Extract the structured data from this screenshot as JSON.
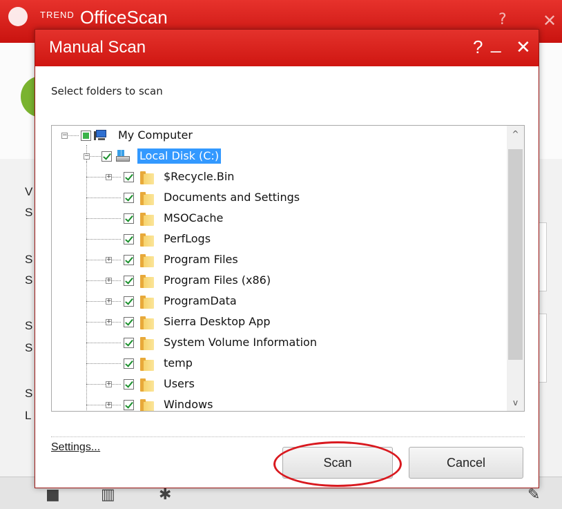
{
  "background_app": {
    "brand": "TREND",
    "product": "OfficeScan",
    "help_glyph": "?",
    "close_glyph": "✕",
    "partial_letters": [
      "V",
      "S",
      "S",
      "S",
      "S",
      "S",
      "S",
      "L"
    ]
  },
  "dialog": {
    "title": "Manual Scan",
    "help_glyph": "?",
    "minimize_glyph": "_",
    "close_glyph": "✕",
    "instruction": "Select folders to scan",
    "tree": {
      "root": {
        "label": "My Computer",
        "state": "partial",
        "expanded": true,
        "icon": "computer-icon"
      },
      "drive": {
        "label": "Local Disk (C:)",
        "state": "checked",
        "expanded": true,
        "selected": true,
        "icon": "disk-icon"
      },
      "folders": [
        {
          "label": "$Recycle.Bin",
          "expandable": true
        },
        {
          "label": "Documents and Settings",
          "expandable": false
        },
        {
          "label": "MSOCache",
          "expandable": false
        },
        {
          "label": "PerfLogs",
          "expandable": false
        },
        {
          "label": "Program Files",
          "expandable": true
        },
        {
          "label": "Program Files (x86)",
          "expandable": true
        },
        {
          "label": "ProgramData",
          "expandable": true
        },
        {
          "label": "Sierra Desktop App",
          "expandable": true
        },
        {
          "label": "System Volume Information",
          "expandable": false
        },
        {
          "label": "temp",
          "expandable": false
        },
        {
          "label": "Users",
          "expandable": true
        },
        {
          "label": "Windows",
          "expandable": true
        }
      ]
    },
    "scroll_up_glyph": "^",
    "scroll_down_glyph": "v",
    "settings_link": "Settings...",
    "scan_button": "Scan",
    "cancel_button": "Cancel"
  },
  "colors": {
    "title_red": "#d8201b",
    "selection_blue": "#3399ff",
    "check_green": "#1a8f2c",
    "highlight_ring": "#d9191f"
  }
}
